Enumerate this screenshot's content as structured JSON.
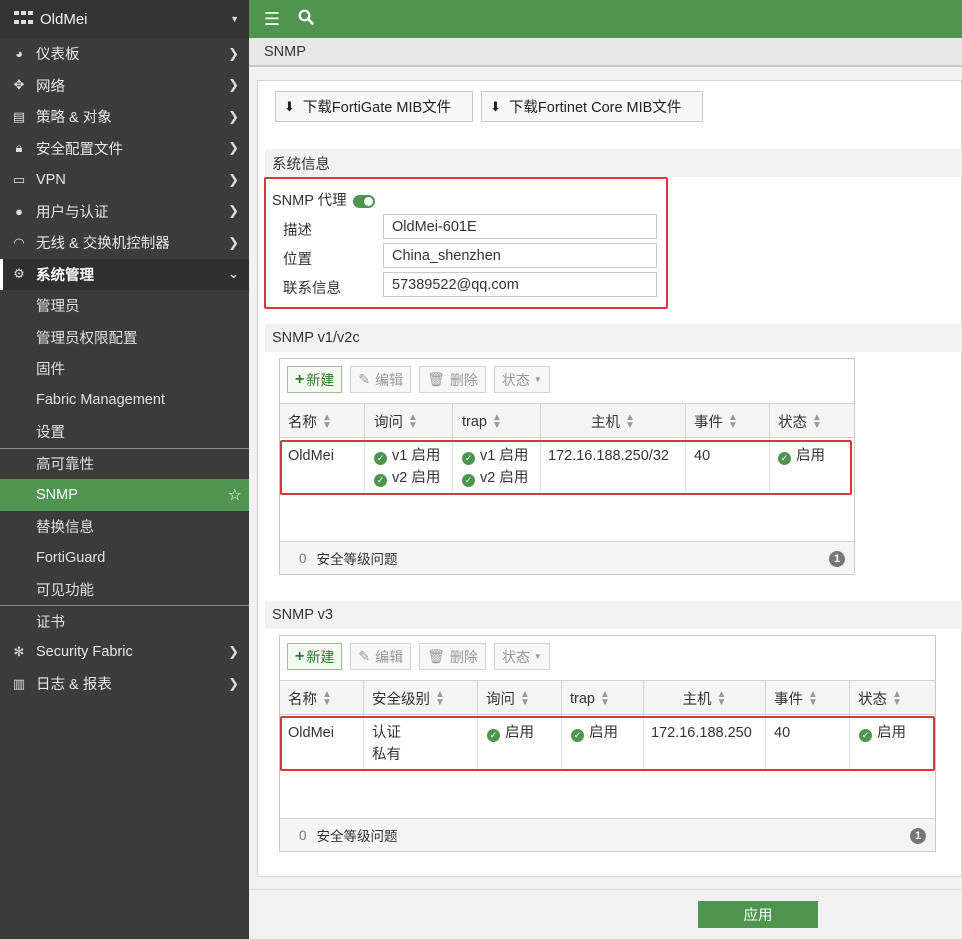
{
  "sidebar": {
    "title": "OldMei",
    "items": [
      {
        "label": "仪表板",
        "icon": "dashboard-icon"
      },
      {
        "label": "网络",
        "icon": "network-icon"
      },
      {
        "label": "策略 & 对象",
        "icon": "policy-icon"
      },
      {
        "label": "安全配置文件",
        "icon": "lock-icon"
      },
      {
        "label": "VPN",
        "icon": "laptop-icon"
      },
      {
        "label": "用户与认证",
        "icon": "user-icon"
      },
      {
        "label": "无线 & 交换机控制器",
        "icon": "wifi-icon"
      },
      {
        "label": "系统管理",
        "icon": "gear-icon"
      }
    ],
    "sub_items": [
      "管理员",
      "管理员权限配置",
      "固件",
      "Fabric Management",
      "设置",
      "高可靠性",
      "SNMP",
      "替换信息",
      "FortiGuard",
      "可见功能",
      "证书"
    ],
    "bottom_items": [
      {
        "label": "Security Fabric",
        "icon": "fabric-icon"
      },
      {
        "label": "日志 & 报表",
        "icon": "chart-icon"
      }
    ]
  },
  "topbar": {
    "menu_icon": "menu-icon",
    "search_icon": "search-icon"
  },
  "breadcrumb": "SNMP",
  "downloads": {
    "fortigate_mib": "下载FortiGate MIB文件",
    "fortinet_core_mib": "下载Fortinet Core MIB文件"
  },
  "system_info": {
    "heading": "系统信息",
    "agent_label": "SNMP 代理",
    "agent_enabled": true,
    "description_label": "描述",
    "description_value": "OldMei-601E",
    "location_label": "位置",
    "location_value": "China_shenzhen",
    "contact_label": "联系信息",
    "contact_value": "57389522@qq.com"
  },
  "toolbar": {
    "new": "新建",
    "edit": "编辑",
    "delete": "删除",
    "status": "状态"
  },
  "v1v2c": {
    "heading": "SNMP v1/v2c",
    "columns": [
      "名称",
      "询问",
      "trap",
      "主机",
      "事件",
      "状态"
    ],
    "row": {
      "name": "OldMei",
      "query": [
        "v1 启用",
        "v2 启用"
      ],
      "trap": [
        "v1 启用",
        "v2 启用"
      ],
      "host": "172.16.188.250/32",
      "events": "40",
      "status": "启用"
    },
    "footer_count": "0",
    "footer_label": "安全等级问题",
    "badge": "1"
  },
  "v3": {
    "heading": "SNMP v3",
    "columns": [
      "名称",
      "安全级别",
      "询问",
      "trap",
      "主机",
      "事件",
      "状态"
    ],
    "row": {
      "name": "OldMei",
      "security_level": [
        "认证",
        "私有"
      ],
      "query": "启用",
      "trap": "启用",
      "host": "172.16.188.250",
      "events": "40",
      "status": "启用"
    },
    "footer_count": "0",
    "footer_label": "安全等级问题",
    "badge": "1"
  },
  "apply_label": "应用",
  "colors": {
    "accent": "#4f9550",
    "sidebar_bg": "#3b3b3b",
    "highlight": "#d9363e"
  }
}
